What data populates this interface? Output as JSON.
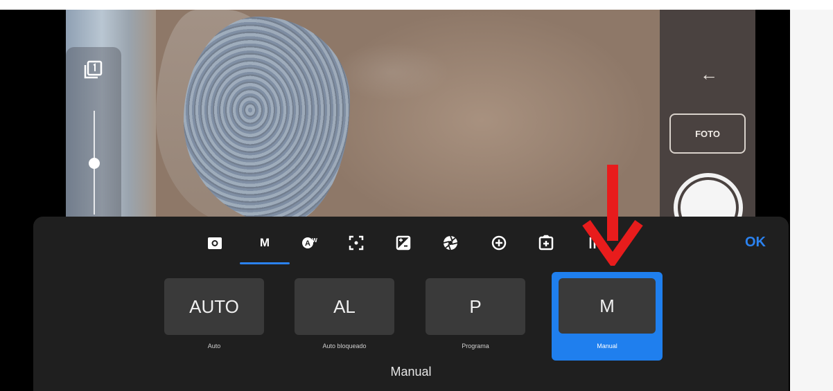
{
  "camera": {
    "back_icon": "arrow-left-icon",
    "foto_label": "FOTO",
    "multi_icon": "multi-shot-icon"
  },
  "toolbar": {
    "tabs": [
      {
        "name": "camera-icon",
        "label": ""
      },
      {
        "name": "manual-mode-tab",
        "label": "M"
      },
      {
        "name": "auto-white-balance-icon",
        "label": ""
      },
      {
        "name": "focus-icon",
        "label": ""
      },
      {
        "name": "exposure-compensation-icon",
        "label": ""
      },
      {
        "name": "aperture-icon",
        "label": ""
      },
      {
        "name": "add-circle-icon",
        "label": ""
      },
      {
        "name": "image-adjust-icon",
        "label": ""
      },
      {
        "name": "more-icon",
        "label": ""
      }
    ],
    "ok_label": "OK"
  },
  "modes": [
    {
      "short": "AUTO",
      "label": "Auto"
    },
    {
      "short": "AL",
      "label": "Auto bloqueado"
    },
    {
      "short": "P",
      "label": "Programa"
    },
    {
      "short": "M",
      "label": "Manual",
      "selected": true
    }
  ],
  "current_mode": "Manual",
  "colors": {
    "accent": "#1f7fee",
    "annotation": "#e81c1c",
    "sheet": "#1f1f1f"
  },
  "nav": {
    "back_icon": "chevron-left-icon",
    "home_icon": "home-circle-icon",
    "recents_icon": "recents-icon"
  }
}
